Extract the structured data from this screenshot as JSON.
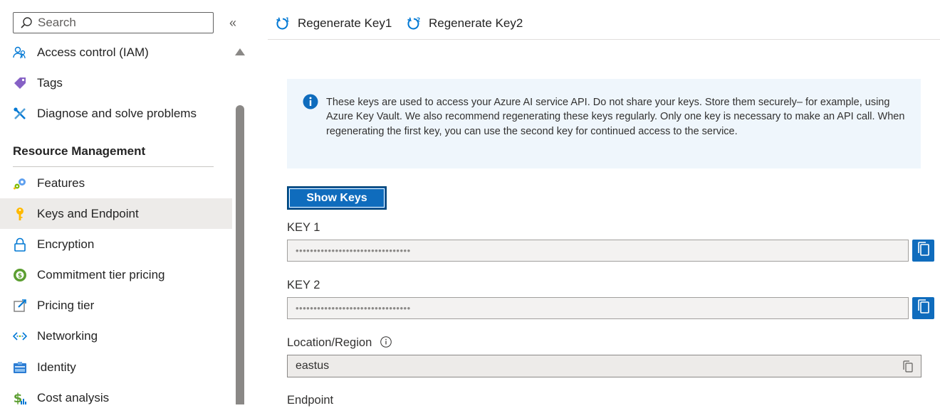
{
  "sidebar": {
    "search_placeholder": "Search",
    "collapse_glyph": "«",
    "section_header": "Resource Management",
    "items": [
      {
        "label": "Access control (IAM)",
        "icon": "people-icon"
      },
      {
        "label": "Tags",
        "icon": "tag-icon"
      },
      {
        "label": "Diagnose and solve problems",
        "icon": "wrench-icon"
      },
      {
        "label": "Features",
        "icon": "gears-icon"
      },
      {
        "label": "Keys and Endpoint",
        "icon": "key-icon",
        "active": true
      },
      {
        "label": "Encryption",
        "icon": "lock-icon"
      },
      {
        "label": "Commitment tier pricing",
        "icon": "coin-icon"
      },
      {
        "label": "Pricing tier",
        "icon": "edit-square-icon"
      },
      {
        "label": "Networking",
        "icon": "network-icon"
      },
      {
        "label": "Identity",
        "icon": "id-badge-icon"
      },
      {
        "label": "Cost analysis",
        "icon": "dollar-icon"
      }
    ]
  },
  "toolbar": {
    "regen1_label": "Regenerate Key1",
    "regen2_label": "Regenerate Key2"
  },
  "info": {
    "text": "These keys are used to access your Azure AI service API. Do not share your keys. Store them securely– for example, using Azure Key Vault. We also recommend regenerating these keys regularly. Only one key is necessary to make an API call. When regenerating the first key, you can use the second key for continued access to the service."
  },
  "show_keys_label": "Show Keys",
  "key1": {
    "label": "KEY 1",
    "value": "••••••••••••••••••••••••••••••••"
  },
  "key2": {
    "label": "KEY 2",
    "value": "••••••••••••••••••••••••••••••••"
  },
  "location": {
    "label": "Location/Region",
    "value": "eastus"
  },
  "endpoint": {
    "label": "Endpoint"
  },
  "colors": {
    "accent": "#0f6cbd",
    "info_bg": "#eff6fc",
    "active_bg": "#edebe9"
  }
}
